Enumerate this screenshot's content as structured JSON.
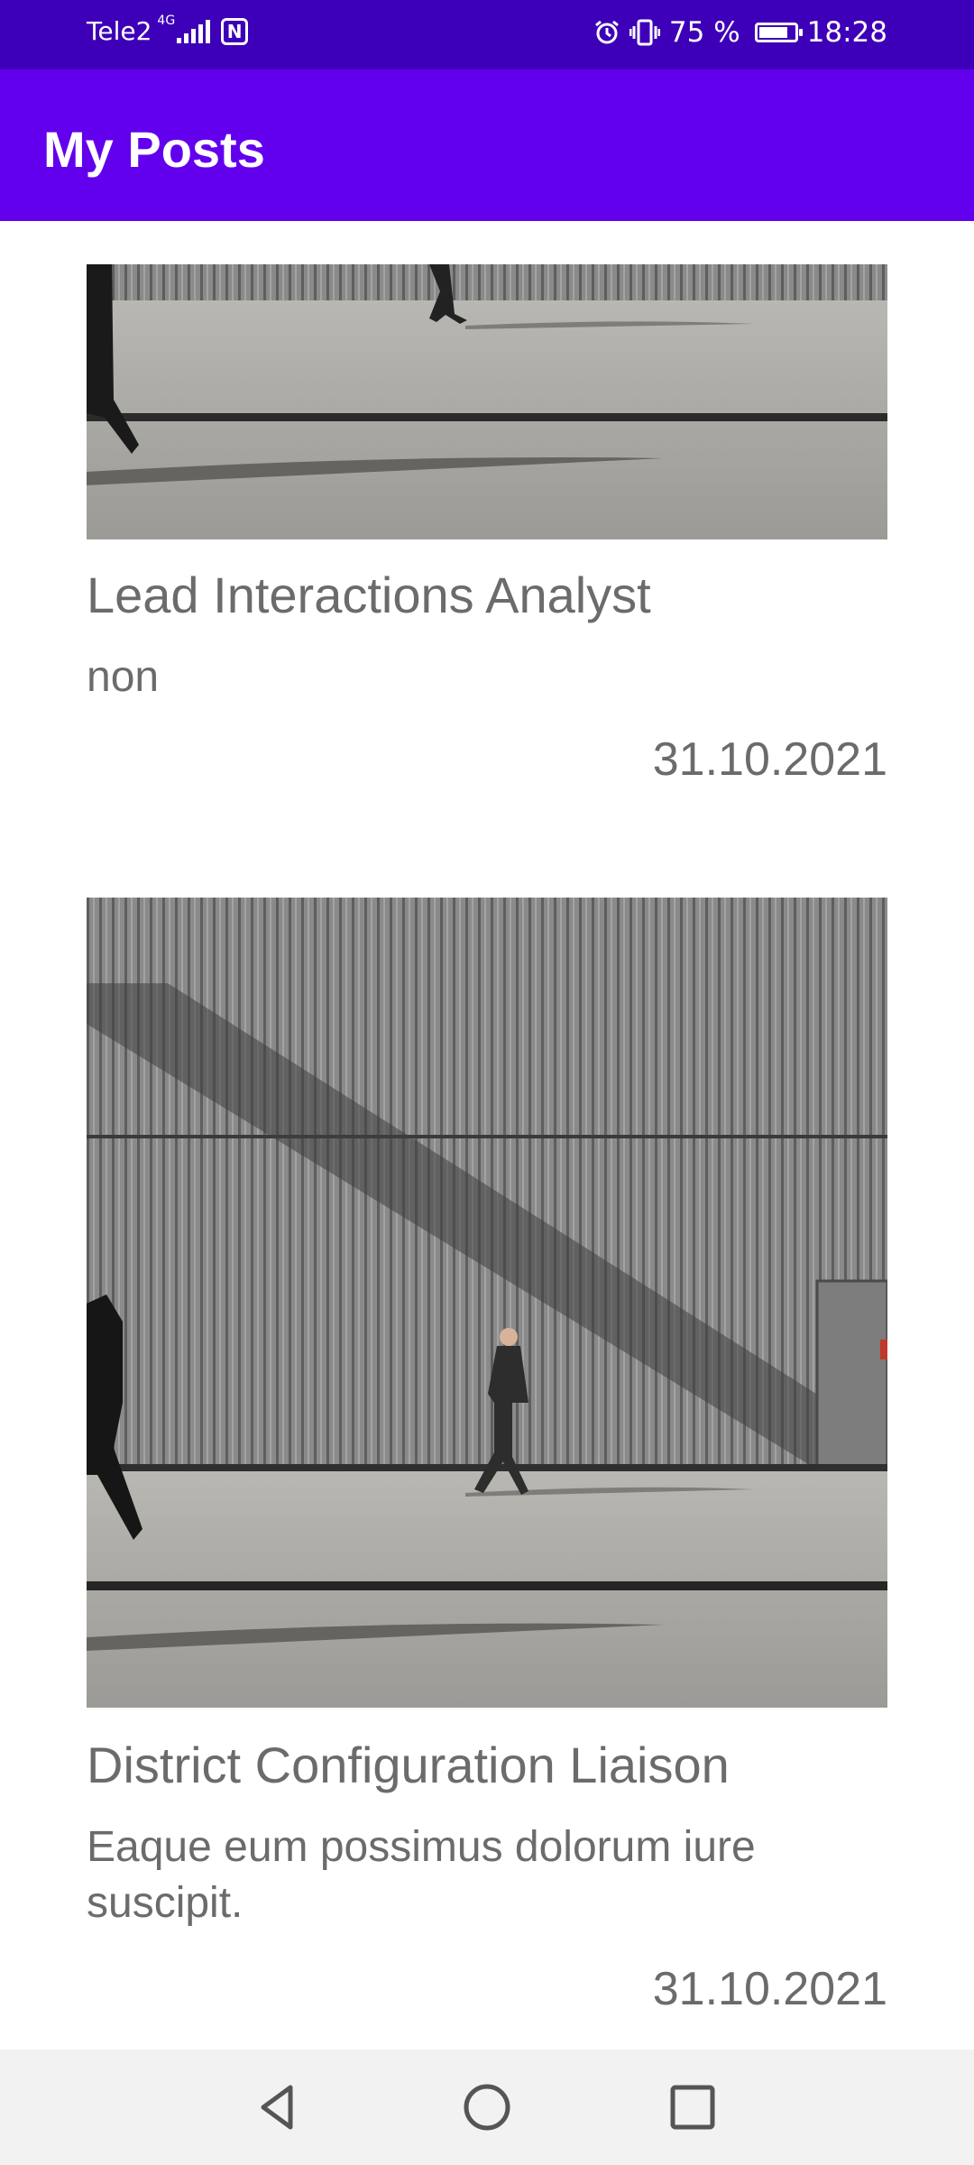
{
  "status_bar": {
    "carrier": "Tele2",
    "network_type": "4G",
    "nfc_icon": "nfc-icon",
    "battery_percent": "75 %",
    "battery_level": 0.75,
    "time": "18:28"
  },
  "app_bar": {
    "title": "My Posts"
  },
  "posts": [
    {
      "title": "Lead Interactions Analyst",
      "body": "non",
      "date": "31.10.2021",
      "image": "photo-man-walking-past-metal-wall"
    },
    {
      "title": "District Configuration Liaison",
      "body": "Eaque eum possimus dolorum iure suscipit.",
      "date": "31.10.2021",
      "image": "photo-man-walking-past-metal-wall"
    }
  ],
  "nav_bar": {
    "back_icon": "back-triangle-icon",
    "home_icon": "home-circle-icon",
    "recents_icon": "recents-square-icon"
  }
}
